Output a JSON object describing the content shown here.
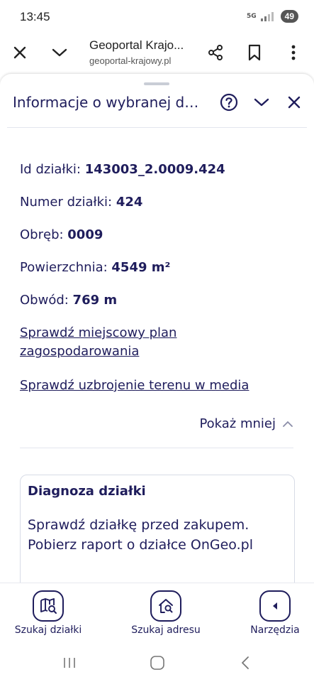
{
  "status_bar": {
    "time": "13:45",
    "network": "5G",
    "battery": "49"
  },
  "browser": {
    "page_title": "Geoportal Krajo...",
    "url": "geoportal-krajowy.pl"
  },
  "panel": {
    "title": "Informacje o wybranej dzi...",
    "fields": [
      {
        "label": "Id działki: ",
        "value": "143003_2.0009.424"
      },
      {
        "label": "Numer działki: ",
        "value": "424"
      },
      {
        "label": "Obręb: ",
        "value": "0009"
      },
      {
        "label": "Powierzchnia: ",
        "value": "4549 m²"
      },
      {
        "label": "Obwód: ",
        "value": "769 m"
      }
    ],
    "links": {
      "plan": "Sprawdź miejscowy plan zagospodarowania",
      "media": "Sprawdź uzbrojenie terenu w media"
    },
    "show_less": "Pokaż mniej"
  },
  "diagnosis_card": {
    "title": "Diagnoza działki",
    "text": "Sprawdź działkę przed zakupem. Pobierz raport o działce OnGeo.pl"
  },
  "bottom_nav": {
    "search_parcel": "Szukaj działki",
    "search_address": "Szukaj adresu",
    "tools": "Narzędzia"
  },
  "colors": {
    "primary": "#1f1d5c",
    "divider": "#e3e6ee"
  },
  "icons": [
    "close-icon",
    "chevron-down-icon",
    "share-icon",
    "bookmark-icon",
    "more-vert-icon",
    "help-icon",
    "map-search-icon",
    "home-search-icon",
    "back-icon"
  ]
}
